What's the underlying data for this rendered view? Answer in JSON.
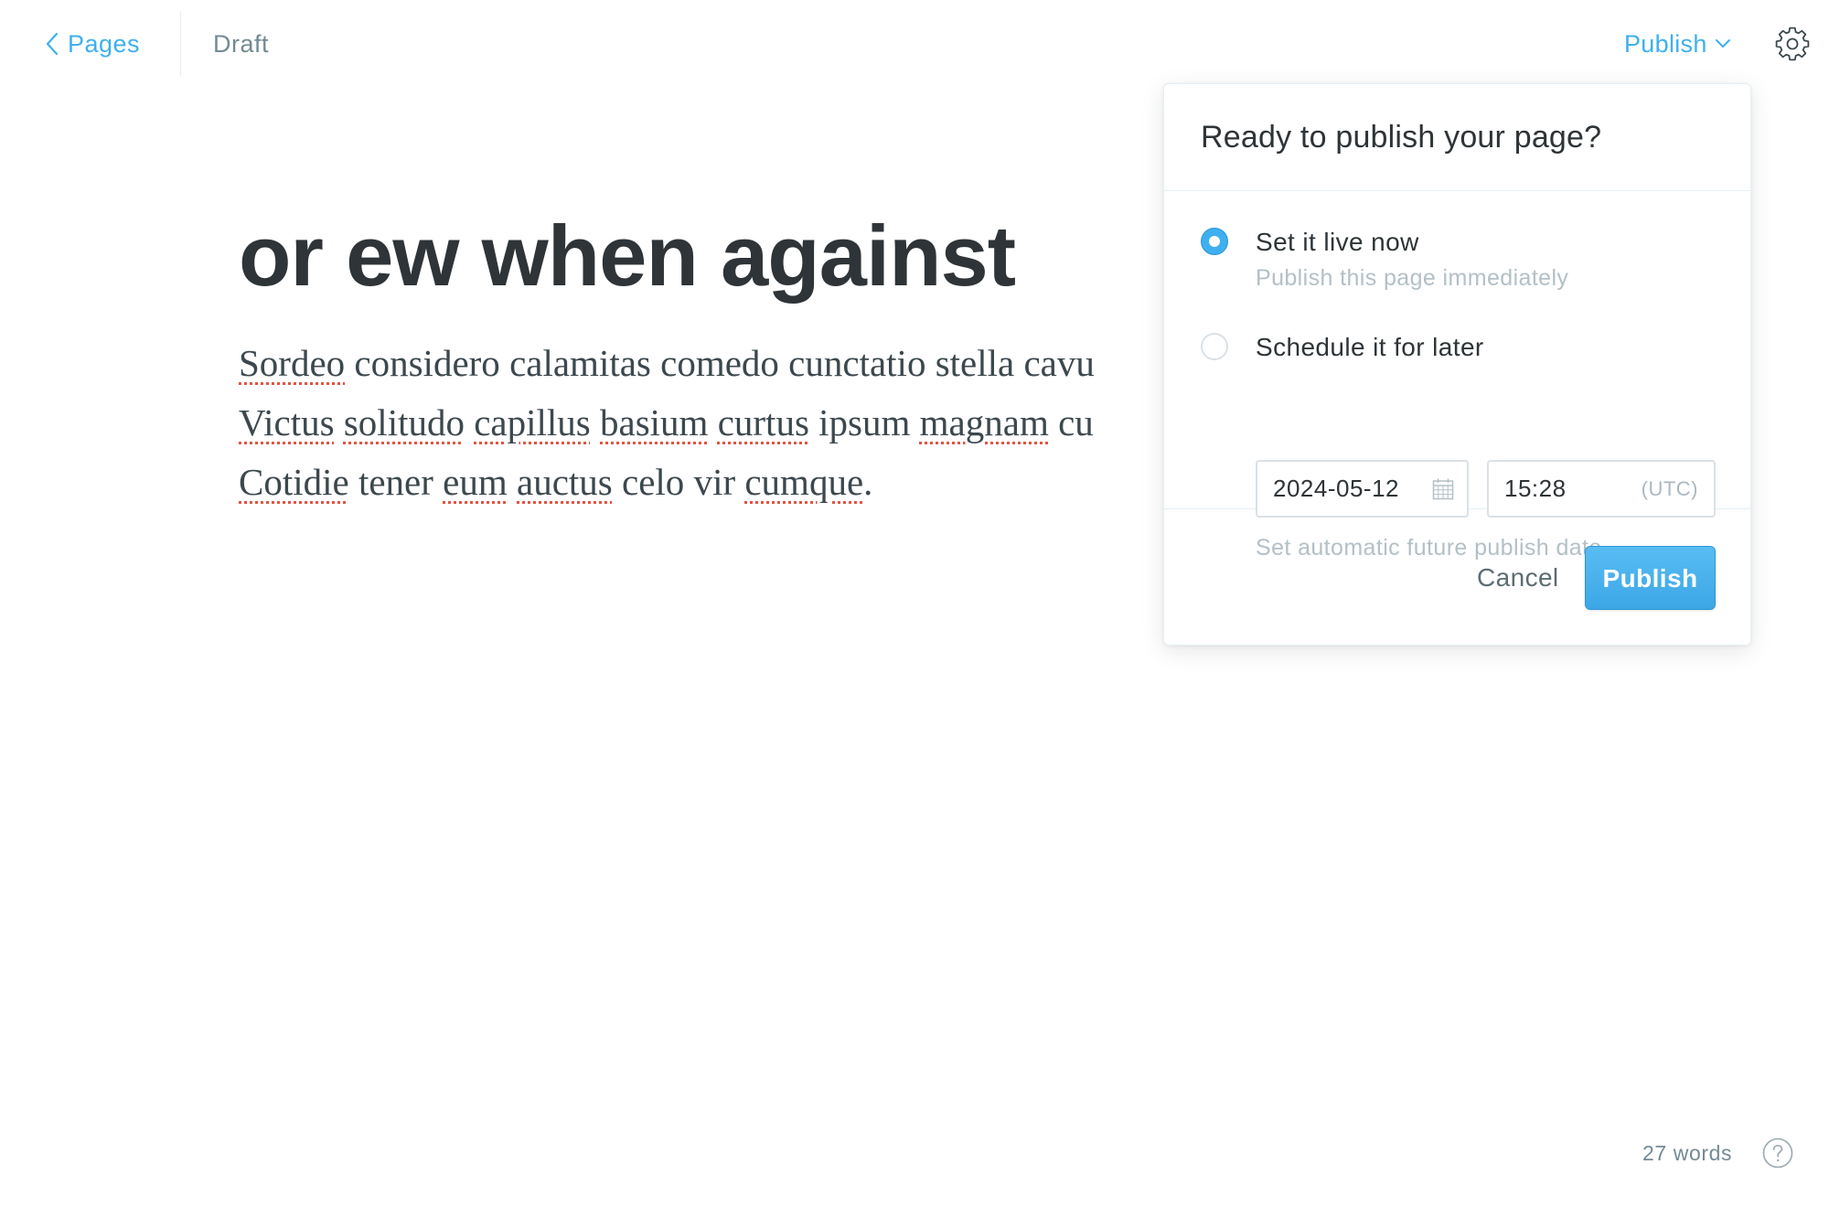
{
  "topbar": {
    "back_label": "Pages",
    "back_icon": "chevron-left-icon",
    "status": "Draft",
    "publish_menu_label": "Publish",
    "publish_menu_icon": "chevron-down-icon",
    "settings_icon": "gear-icon"
  },
  "editor": {
    "title": "or ew when against",
    "body_lines": [
      "Sordeo considero calamitas comedo cunctatio stella cavu",
      "Victus solitudo capillus basium curtus ipsum magnam cu",
      "Cotidie tener eum auctus celo vir cumque."
    ]
  },
  "publish_popover": {
    "title": "Ready to publish your page?",
    "options": [
      {
        "label": "Set it live now",
        "description": "Publish this page immediately",
        "selected": true
      },
      {
        "label": "Schedule it for later",
        "description": "Set automatic future publish date",
        "selected": false
      }
    ],
    "date_value": "2024-05-12",
    "date_icon": "calendar-icon",
    "time_value": "15:28",
    "timezone": "(UTC)",
    "cancel_label": "Cancel",
    "publish_label": "Publish"
  },
  "footer": {
    "word_count": "27 words",
    "help_icon": "question-circle-icon"
  },
  "colors": {
    "accent": "#3eb0ef",
    "text_dark": "#2e3437",
    "text_muted": "#738a94",
    "text_light": "#b3c0c6",
    "border": "#dae1e7",
    "spellcheck": "#e25440"
  }
}
